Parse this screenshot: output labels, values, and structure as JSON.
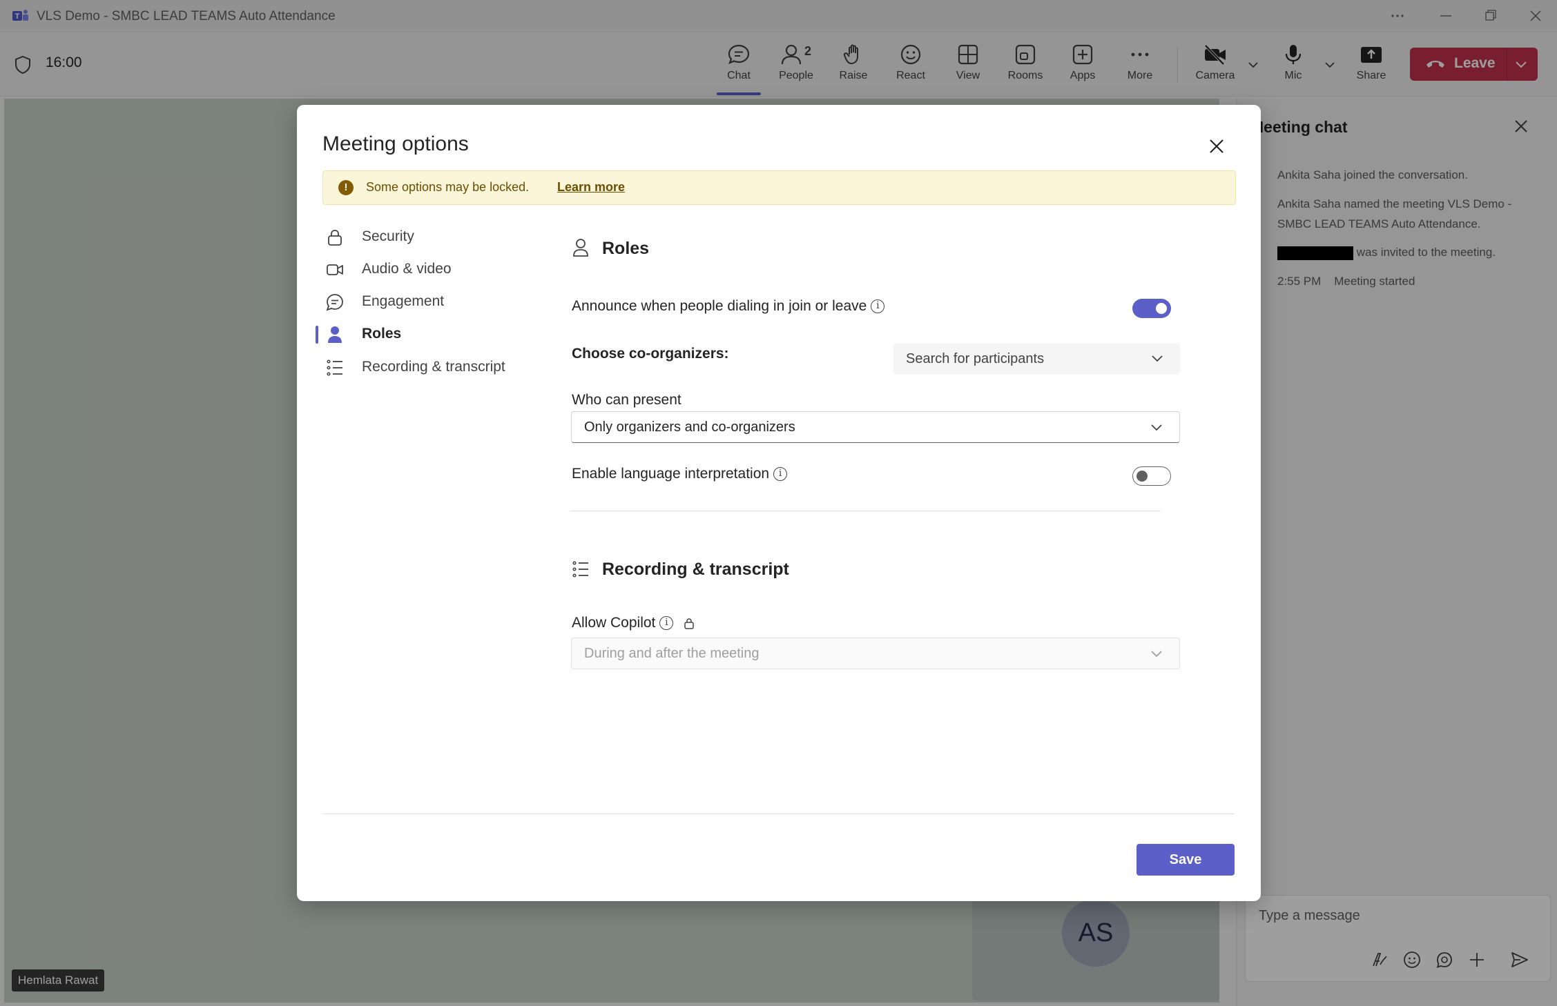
{
  "window": {
    "title": "VLS Demo - SMBC LEAD TEAMS Auto Attendance"
  },
  "toolbar": {
    "timer": "16:00",
    "buttons": [
      {
        "label": "Chat",
        "icon": "chat-icon",
        "active": true
      },
      {
        "label": "People",
        "icon": "people-icon",
        "badge": "2"
      },
      {
        "label": "Raise",
        "icon": "raise-hand-icon"
      },
      {
        "label": "React",
        "icon": "react-icon"
      },
      {
        "label": "View",
        "icon": "view-icon"
      },
      {
        "label": "Rooms",
        "icon": "rooms-icon"
      },
      {
        "label": "Apps",
        "icon": "apps-icon"
      },
      {
        "label": "More",
        "icon": "more-icon"
      },
      {
        "label": "Camera",
        "icon": "camera-off-icon"
      },
      {
        "label": "Mic",
        "icon": "mic-icon"
      },
      {
        "label": "Share",
        "icon": "share-icon"
      }
    ],
    "leave_label": "Leave",
    "leave_color": "#c4314b"
  },
  "chat": {
    "title": "Meeting chat",
    "messages": [
      "Ankita Saha joined the conversation.",
      "Ankita Saha named the meeting VLS Demo -",
      "SMBC LEAD TEAMS Auto Attendance.",
      "was invited to the meeting."
    ],
    "event_time": "2:55 PM",
    "event_text": "Meeting started",
    "composer_placeholder": "Type a message"
  },
  "stage": {
    "avatar_initials": "AS",
    "name_tag": "Hemlata Rawat"
  },
  "modal": {
    "title": "Meeting options",
    "banner": {
      "text": "Some options may be locked.",
      "link": "Learn more"
    },
    "nav": [
      {
        "label": "Security",
        "icon": "lock-icon"
      },
      {
        "label": "Audio & video",
        "icon": "video-icon"
      },
      {
        "label": "Engagement",
        "icon": "engagement-icon"
      },
      {
        "label": "Roles",
        "icon": "person-icon",
        "active": true
      },
      {
        "label": "Recording & transcript",
        "icon": "list-icon"
      }
    ],
    "roles": {
      "title": "Roles",
      "announce_label": "Announce when people dialing in join or leave",
      "announce_on": true,
      "coorganizers_label": "Choose co-organizers:",
      "coorganizers_placeholder": "Search for participants",
      "present_label": "Who can present",
      "present_value": "Only organizers and co-organizers",
      "interpretation_label": "Enable language interpretation",
      "interpretation_on": false
    },
    "recording": {
      "title": "Recording & transcript",
      "copilot_label": "Allow Copilot",
      "copilot_value": "During and after the meeting"
    },
    "save_label": "Save",
    "accent_color": "#5b5fc7"
  }
}
